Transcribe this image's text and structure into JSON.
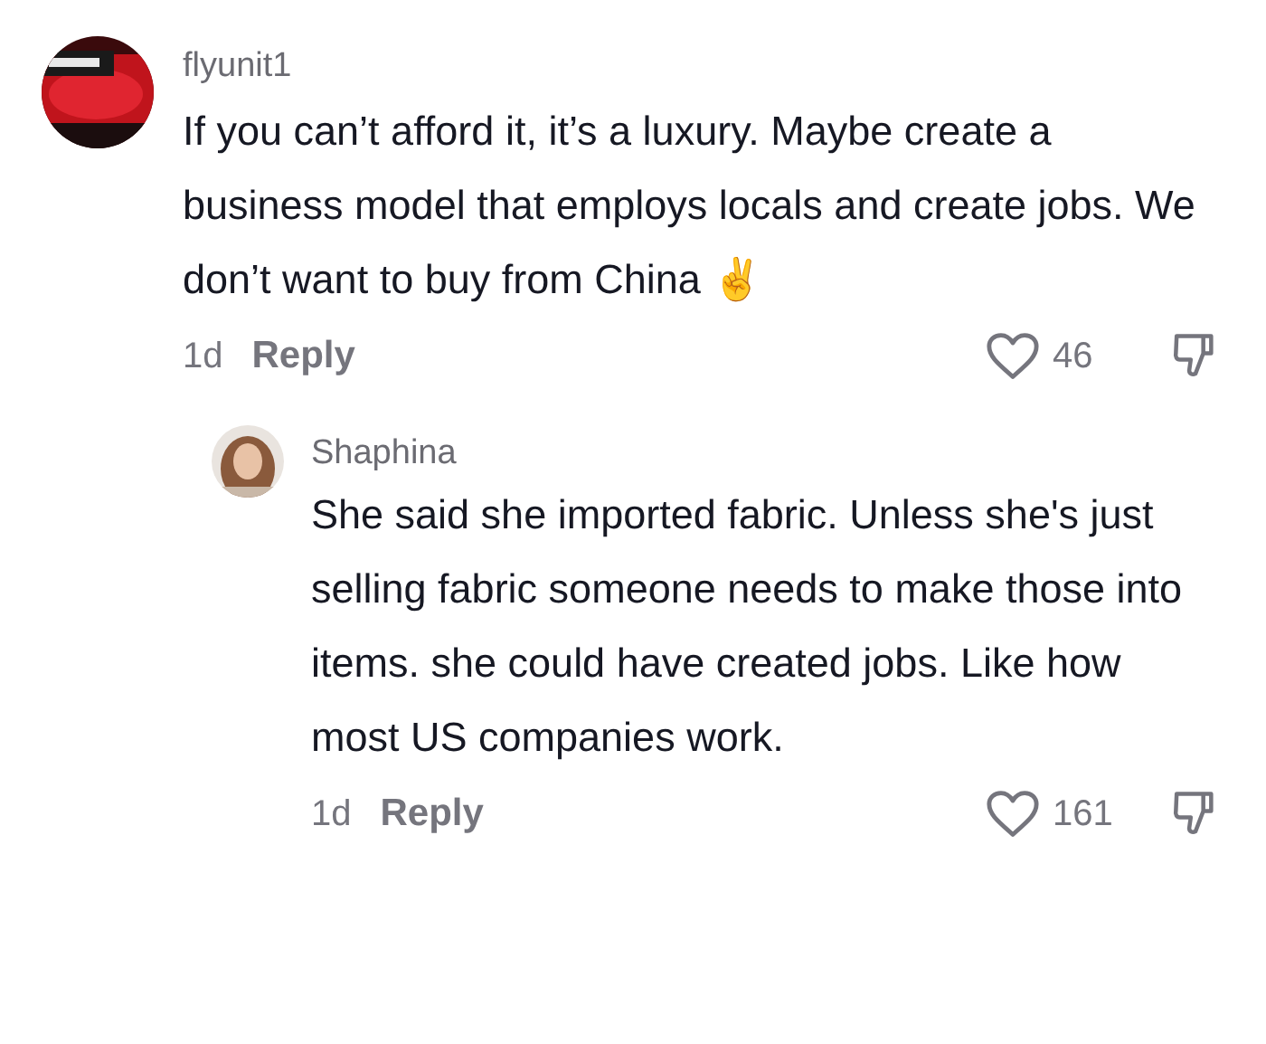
{
  "comments": [
    {
      "username": "flyunit1",
      "text": "If you can’t afford it, it’s a luxury. Maybe create a business model that employs locals and create jobs. We don’t want to buy from China ✌️",
      "time": "1d",
      "reply_label": "Reply",
      "likes": "46",
      "replies": [
        {
          "username": "Shaphina",
          "text": "She said she imported fabric. Unless she's just selling fabric someone needs to make those into items. she could have created jobs. Like how most US companies work.",
          "time": "1d",
          "reply_label": "Reply",
          "likes": "161"
        }
      ]
    }
  ]
}
